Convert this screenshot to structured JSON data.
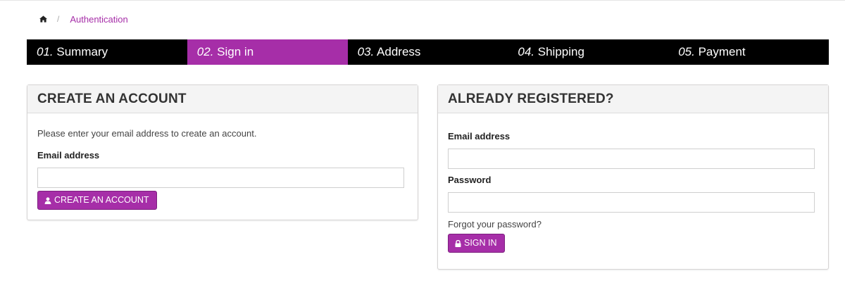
{
  "breadcrumb": {
    "home_icon": "home-icon",
    "separator": "/",
    "current": "Authentication"
  },
  "steps": [
    {
      "num": "01.",
      "label": "Summary",
      "active": false
    },
    {
      "num": "02.",
      "label": "Sign in",
      "active": true
    },
    {
      "num": "03.",
      "label": "Address",
      "active": false
    },
    {
      "num": "04.",
      "label": "Shipping",
      "active": false
    },
    {
      "num": "05.",
      "label": "Payment",
      "active": false
    }
  ],
  "create_account": {
    "title": "CREATE AN ACCOUNT",
    "intro": "Please enter your email address to create an account.",
    "email_label": "Email address",
    "email_value": "",
    "button_label": "CREATE AN ACCOUNT",
    "button_icon": "user-icon"
  },
  "login": {
    "title": "ALREADY REGISTERED?",
    "email_label": "Email address",
    "email_value": "",
    "password_label": "Password",
    "password_value": "",
    "forgot_link": "Forgot your password?",
    "button_label": "SIGN IN",
    "button_icon": "lock-icon"
  },
  "colors": {
    "accent": "#a62ea8",
    "step_bar": "#000000",
    "panel_header": "#f4f4f4"
  }
}
